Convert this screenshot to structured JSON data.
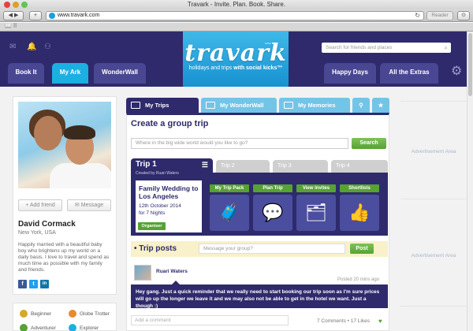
{
  "browser": {
    "title": "Travark - Invite. Plan. Book. Share.",
    "url": "www.travark.com",
    "reader_label": "Reader",
    "reload_glyph": "↻"
  },
  "header": {
    "logo_word": "travark",
    "logo_tagline_plain": "holidays and trips",
    "logo_tagline_bold": "with social kicks™",
    "search_placeholder": "Search for friends and places",
    "nav_left": [
      "Book It",
      "My Ark",
      "WonderWall"
    ],
    "nav_right": [
      "Happy Days",
      "All the Extras"
    ],
    "active_tab": "My Ark",
    "accent_color": "#1cb0e2",
    "brand_color": "#2e2a6c",
    "icons": [
      "mail-icon",
      "bell-icon",
      "friends-icon",
      "search-icon",
      "gear-icon"
    ]
  },
  "profile": {
    "add_friend_label": "+ Add friend",
    "message_label": "Message",
    "name": "David Cormack",
    "location": "New York, USA",
    "bio": "Happily married with a beautiful baby boy who brightens up my world on a daily basis. I love to travel and spend as much time as possible with my family and friends.",
    "social": [
      "f",
      "t",
      "in"
    ],
    "badges": [
      "Beginner",
      "Globe Trotter",
      "Adventurer",
      "Explorer"
    ]
  },
  "main": {
    "tabs": [
      "My Trips",
      "My WonderWall",
      "My Memories"
    ],
    "create_title": "Create a group trip",
    "create_placeholder": "Where in the big wide world would you like to go?",
    "search_button": "Search",
    "trip_tabs": [
      "Trip 1",
      "Trip 2",
      "Trip 3",
      "Trip 4"
    ],
    "trip_created_by": "Created by Ruari Waters",
    "trip": {
      "title": "Family Wedding to Los Angeles",
      "date": "12th October 2014",
      "nights": "for 7 Nights",
      "role": "Organiser"
    },
    "tools": [
      "My Trip Pack",
      "Plan Trip",
      "View Invites",
      "Shortlists"
    ],
    "posts_title": "• Trip posts",
    "posts_placeholder": "Message your group?",
    "post_button": "Post",
    "post": {
      "author": "Ruari Waters",
      "posted": "Posted 20 mins ago",
      "message": "Hey gang. Just a quick reminder that we really need to start booking our trip soon as I'm sure prices will go up the longer we leave it and we may also not be able to get in the hotel we want. Just a though :)"
    },
    "comment_placeholder": "Add a comment",
    "stats": "7 Comments  •  17 Likes"
  },
  "ads": [
    "Advertisement Area",
    "Advertisement Area"
  ]
}
